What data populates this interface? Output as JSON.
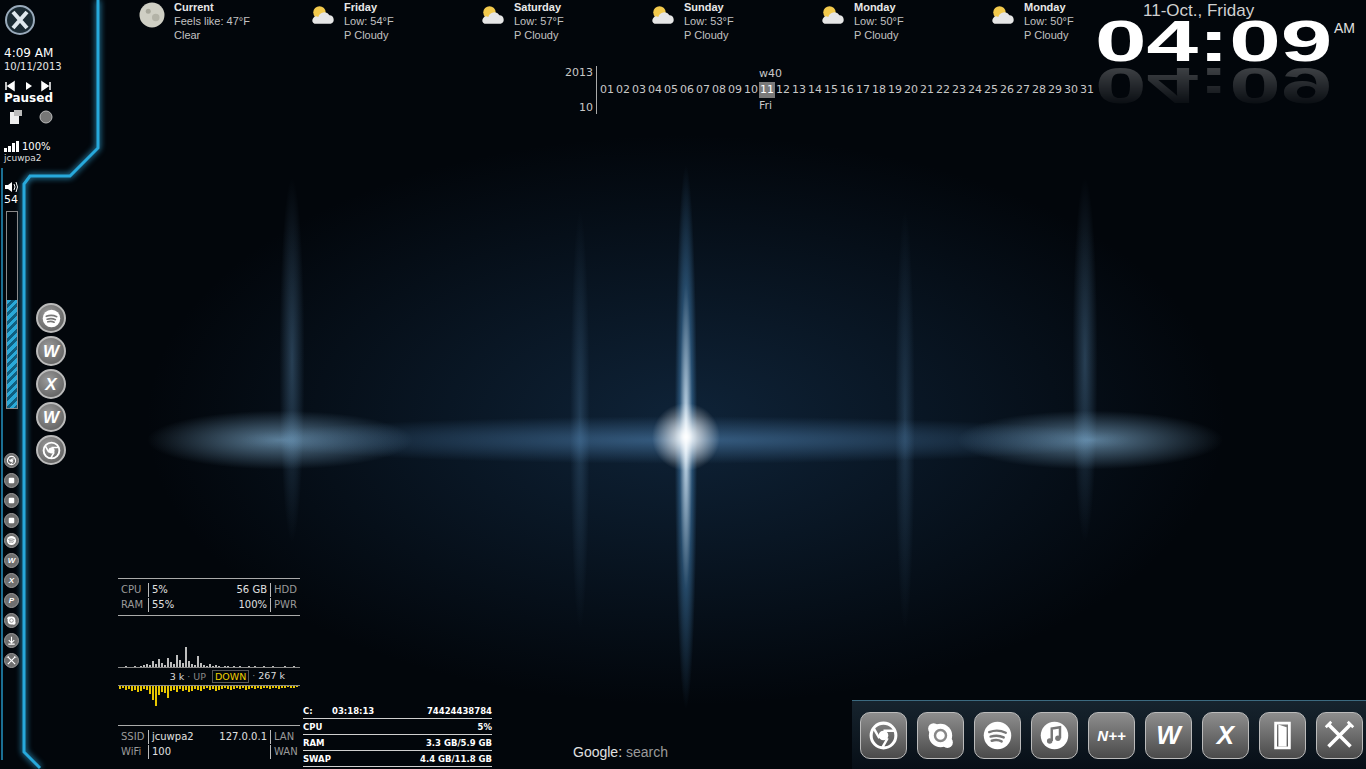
{
  "sidebar": {
    "time": "4:09 AM",
    "date": "10/11/2013",
    "media_state": "Paused",
    "signal": {
      "reading": "100%",
      "level": 1
    },
    "network": "jcuwpa2",
    "volume": {
      "reading": "54",
      "level": 0.55
    },
    "launcher": [
      {
        "kind": "spotify"
      },
      {
        "kind": "letter",
        "glyph": "W"
      },
      {
        "kind": "letter",
        "glyph": "X"
      },
      {
        "kind": "letter",
        "glyph": "W"
      },
      {
        "kind": "chrome"
      }
    ],
    "quick_icons": [
      {
        "kind": "chrome"
      },
      {
        "kind": "generic"
      },
      {
        "kind": "generic"
      },
      {
        "kind": "generic"
      },
      {
        "kind": "spotify"
      },
      {
        "kind": "letter",
        "glyph": "W"
      },
      {
        "kind": "letter",
        "glyph": "X"
      },
      {
        "kind": "letter",
        "glyph": "P"
      },
      {
        "kind": "skype"
      },
      {
        "kind": "download"
      },
      {
        "kind": "tools"
      }
    ]
  },
  "weather": [
    {
      "day": "Current",
      "line1": "Feels like: 47°F",
      "line2": "Clear",
      "kind": "moon"
    },
    {
      "day": "Friday",
      "line1": "Low: 54°F",
      "line2": "P Cloudy",
      "kind": "partly-cloudy"
    },
    {
      "day": "Saturday",
      "line1": "Low: 57°F",
      "line2": "P Cloudy",
      "kind": "partly-cloudy"
    },
    {
      "day": "Sunday",
      "line1": "Low: 53°F",
      "line2": "P Cloudy",
      "kind": "partly-cloudy"
    },
    {
      "day": "Monday",
      "line1": "Low: 50°F",
      "line2": "P Cloudy",
      "kind": "partly-cloudy"
    },
    {
      "day": "Monday",
      "line1": "Low: 50°F",
      "line2": "P Cloudy",
      "kind": "partly-cloudy"
    }
  ],
  "calendar": {
    "year": "2013",
    "month": "10",
    "week": "w40",
    "weekday": "Fri",
    "days": [
      {
        "label": "01",
        "selected": false
      },
      {
        "label": "02",
        "selected": false
      },
      {
        "label": "03",
        "selected": false
      },
      {
        "label": "04",
        "selected": false
      },
      {
        "label": "05",
        "selected": false
      },
      {
        "label": "06",
        "selected": false
      },
      {
        "label": "07",
        "selected": false
      },
      {
        "label": "08",
        "selected": false
      },
      {
        "label": "09",
        "selected": false
      },
      {
        "label": "10",
        "selected": false
      },
      {
        "label": "11",
        "selected": true
      },
      {
        "label": "12",
        "selected": false
      },
      {
        "label": "13",
        "selected": false
      },
      {
        "label": "14",
        "selected": false
      },
      {
        "label": "15",
        "selected": false
      },
      {
        "label": "16",
        "selected": false
      },
      {
        "label": "17",
        "selected": false
      },
      {
        "label": "18",
        "selected": false
      },
      {
        "label": "19",
        "selected": false
      },
      {
        "label": "20",
        "selected": false
      },
      {
        "label": "21",
        "selected": false
      },
      {
        "label": "22",
        "selected": false
      },
      {
        "label": "23",
        "selected": false
      },
      {
        "label": "24",
        "selected": false
      },
      {
        "label": "25",
        "selected": false
      },
      {
        "label": "26",
        "selected": false
      },
      {
        "label": "27",
        "selected": false
      },
      {
        "label": "28",
        "selected": false
      },
      {
        "label": "29",
        "selected": false
      },
      {
        "label": "30",
        "selected": false
      },
      {
        "label": "31",
        "selected": false
      }
    ]
  },
  "clock": {
    "date": "11-Oct., Friday",
    "time": "04:09",
    "meridiem": "AM"
  },
  "system": {
    "rows": [
      {
        "label": "CPU",
        "value": "5%",
        "value2": "56 GB",
        "label2": "HDD"
      },
      {
        "label": "RAM",
        "value": "55%",
        "value2": "100%",
        "label2": "PWR"
      }
    ]
  },
  "network": {
    "up": "3 k",
    "up_label": "UP",
    "separator": "·",
    "down_label": "DOWN",
    "down": "267 k",
    "up_series": [
      0,
      0,
      1,
      0,
      0,
      1,
      0,
      1,
      2,
      3,
      2,
      6,
      3,
      8,
      4,
      2,
      9,
      5,
      3,
      12,
      7,
      4,
      20,
      6,
      3,
      2,
      11,
      4,
      2,
      1,
      3,
      1,
      2,
      1,
      0,
      1,
      1,
      0,
      1,
      0,
      1,
      0,
      0,
      1,
      0,
      1,
      0,
      0,
      1,
      0,
      0,
      1,
      0,
      0,
      0,
      1,
      0,
      0,
      1,
      0
    ],
    "down_series": [
      3,
      2,
      4,
      3,
      5,
      4,
      6,
      5,
      3,
      4,
      8,
      14,
      20,
      9,
      6,
      7,
      12,
      5,
      4,
      6,
      3,
      5,
      4,
      6,
      5,
      3,
      4,
      5,
      3,
      2,
      4,
      3,
      5,
      4,
      3,
      2,
      3,
      4,
      3,
      2,
      3,
      2,
      4,
      3,
      2,
      3,
      2,
      3,
      2,
      2,
      3,
      2,
      2,
      3,
      2,
      2,
      1,
      2,
      2,
      1
    ]
  },
  "wifi": {
    "rows": [
      {
        "label": "SSID",
        "value": "jcuwpa2",
        "value2": "127.0.0.1",
        "label2": "LAN"
      },
      {
        "label": "WiFi",
        "value": "100",
        "label2": "WAN"
      }
    ]
  },
  "drive": {
    "rows": [
      {
        "label": "C:",
        "middle": "03:18:13",
        "value": "74424438784"
      },
      {
        "label": "CPU",
        "value": "5%"
      },
      {
        "label": "RAM",
        "value": "3.3 GB/5.9 GB"
      },
      {
        "label": "SWAP",
        "value": "4.4 GB/11.8 GB"
      }
    ]
  },
  "search": {
    "label": "Google:",
    "placeholder": "search"
  },
  "dock": [
    {
      "kind": "chrome"
    },
    {
      "kind": "skype"
    },
    {
      "kind": "spotify"
    },
    {
      "kind": "music"
    },
    {
      "kind": "notepad",
      "glyph": "N++"
    },
    {
      "kind": "letter",
      "glyph": "W"
    },
    {
      "kind": "letter",
      "glyph": "X"
    },
    {
      "kind": "door"
    },
    {
      "kind": "tools"
    }
  ]
}
